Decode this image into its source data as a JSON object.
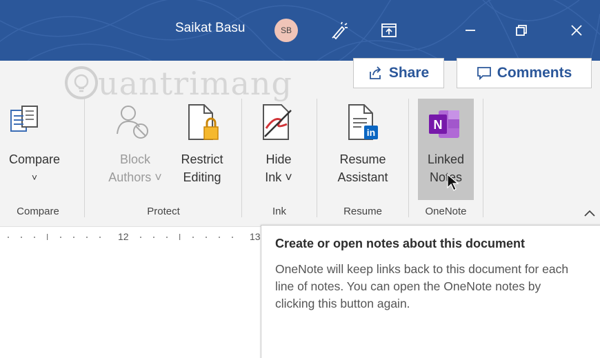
{
  "titlebar": {
    "user_name": "Saikat Basu",
    "avatar_initials": "SB",
    "icons": [
      "pen-sparkle-icon",
      "ribbon-display-icon",
      "minimize-icon",
      "restore-icon",
      "close-icon"
    ],
    "background_color": "#2b579a"
  },
  "watermark": {
    "text": "uantrimang"
  },
  "actions": {
    "share_label": "Share",
    "comments_label": "Comments"
  },
  "ribbon": {
    "commands": {
      "compare": {
        "line1": "Compare",
        "line2": "˅"
      },
      "block_authors": {
        "line1": "Block",
        "line2": "Authors ˅"
      },
      "restrict_editing": {
        "line1": "Restrict",
        "line2": "Editing"
      },
      "hide_ink": {
        "line1": "Hide",
        "line2": "Ink ˅"
      },
      "resume_assistant": {
        "line1": "Resume",
        "line2": "Assistant"
      },
      "linked_notes": {
        "line1": "Linked",
        "line2": "Notes"
      }
    },
    "groups": {
      "compare": "Compare",
      "protect": "Protect",
      "ink": "Ink",
      "resume": "Resume",
      "onenote": "OneNote"
    }
  },
  "ruler": {
    "mark_12": "12",
    "mark_13": "13"
  },
  "tooltip": {
    "title": "Create or open notes about this document",
    "body": "OneNote will keep links back to this document for each line of notes. You can open the OneNote notes by clicking this button again."
  }
}
